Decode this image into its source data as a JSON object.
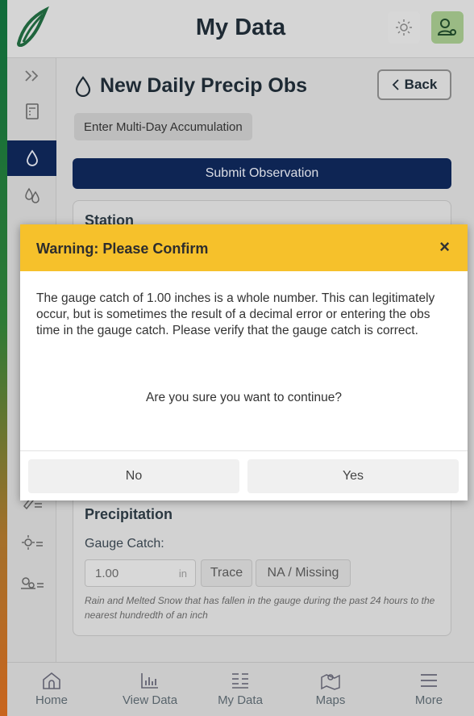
{
  "header": {
    "title": "My Data"
  },
  "page": {
    "title": "New Daily Precip Obs",
    "back_label": "Back",
    "multi_day_label": "Enter Multi-Day Accumulation",
    "submit_label": "Submit Observation"
  },
  "station_card": {
    "title": "Station"
  },
  "precip_card": {
    "title": "Precipitation",
    "gauge_label": "Gauge Catch:",
    "gauge_value": "1.00",
    "gauge_unit": "in",
    "trace_label": "Trace",
    "na_label": "NA / Missing",
    "help": "Rain and Melted Snow that has fallen in the gauge during the past 24 hours to the nearest hundredth of an inch"
  },
  "modal": {
    "title": "Warning: Please Confirm",
    "close": "×",
    "body": "The gauge catch of 1.00 inches is a whole number. This can legitimately occur, but is sometimes the result of a decimal error or entering the obs time in the gauge catch. Please verify that the gauge catch is correct.",
    "confirm": "Are you sure you want to continue?",
    "no_label": "No",
    "yes_label": "Yes"
  },
  "bottom_nav": [
    {
      "label": "Home",
      "icon": "home-icon"
    },
    {
      "label": "View Data",
      "icon": "bar-chart-icon"
    },
    {
      "label": "My Data",
      "icon": "list-icon"
    },
    {
      "label": "Maps",
      "icon": "map-icon"
    },
    {
      "label": "More",
      "icon": "menu-icon"
    }
  ],
  "sidebar": {
    "items": [
      {
        "icon": "expand-icon"
      },
      {
        "icon": "calculator-icon"
      },
      {
        "icon": "droplet-icon",
        "active": true
      },
      {
        "icon": "multi-drop-icon"
      },
      {
        "icon": "chevron-left-icon"
      },
      {
        "icon": "pencil-list-icon"
      },
      {
        "icon": "pen-list-icon"
      },
      {
        "icon": "sun-list-icon"
      },
      {
        "icon": "gears-list-icon"
      }
    ]
  },
  "colors": {
    "accent_navy": "#0d2558",
    "warning_yellow": "#f6c12b",
    "user_green": "#a4c78c"
  }
}
